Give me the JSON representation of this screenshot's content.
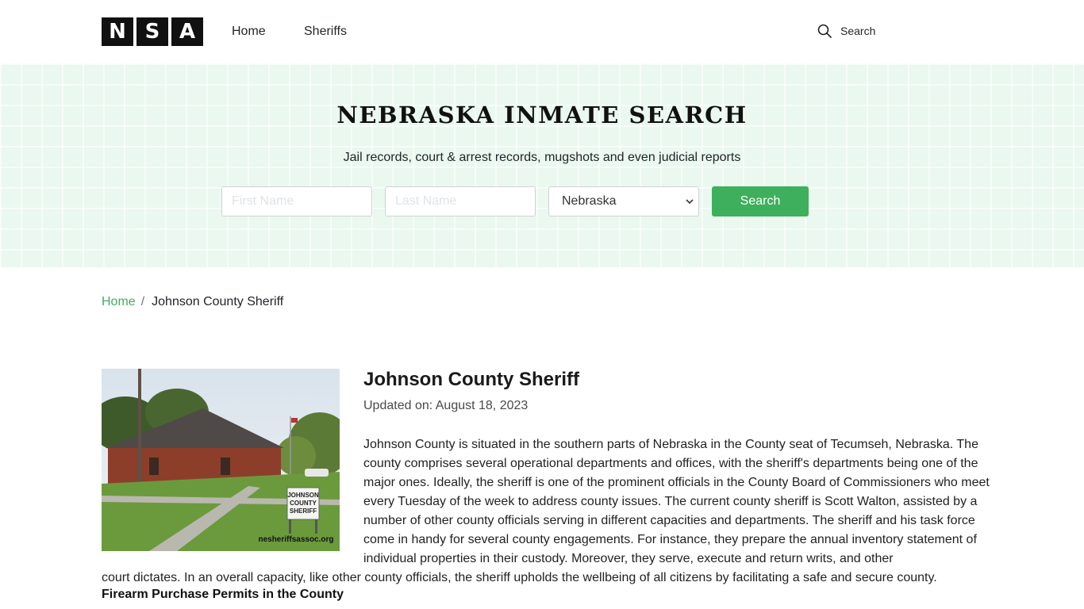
{
  "header": {
    "logo_letters": [
      "N",
      "S",
      "A"
    ],
    "nav": {
      "home": "Home",
      "sheriffs": "Sheriffs"
    },
    "search_label": "Search"
  },
  "hero": {
    "title": "NEBRASKA INMATE SEARCH",
    "subtitle": "Jail records, court & arrest records, mugshots and even judicial reports",
    "first_name_placeholder": "First Name",
    "last_name_placeholder": "Last Name",
    "state_selected": "Nebraska",
    "search_button": "Search",
    "accent_color": "#3eaf5c"
  },
  "breadcrumb": {
    "home": "Home",
    "separator": "/",
    "current": "Johnson County Sheriff"
  },
  "article": {
    "image_watermark": "nesheriffsassoc.org",
    "sign_text": [
      "JOHNSON",
      "COUNTY",
      "SHERIFF"
    ],
    "title": "Johnson County Sheriff",
    "updated": "Updated on: August 18, 2023",
    "paragraph": "Johnson County is situated in the southern parts of Nebraska in the County seat of Tecumseh, Nebraska. The county comprises several operational departments and offices, with the sheriff's departments being one of the major ones. Ideally, the sheriff is one of the prominent officials in the County Board of Commissioners who meet every Tuesday of the week to address county issues. The current county sheriff is Scott Walton, assisted by a number of other county officials serving in different capacities and departments. The sheriff and his task force come in handy for several county engagements. For instance, they prepare the annual inventory statement of individual properties in their custody. Moreover, they serve, execute and return writs, and other",
    "paragraph_tail": "court dictates. In an overall capacity, like other county officials, the sheriff upholds the wellbeing of all citizens by facilitating a safe and secure county.",
    "subheading": "Firearm Purchase Permits in the County"
  }
}
